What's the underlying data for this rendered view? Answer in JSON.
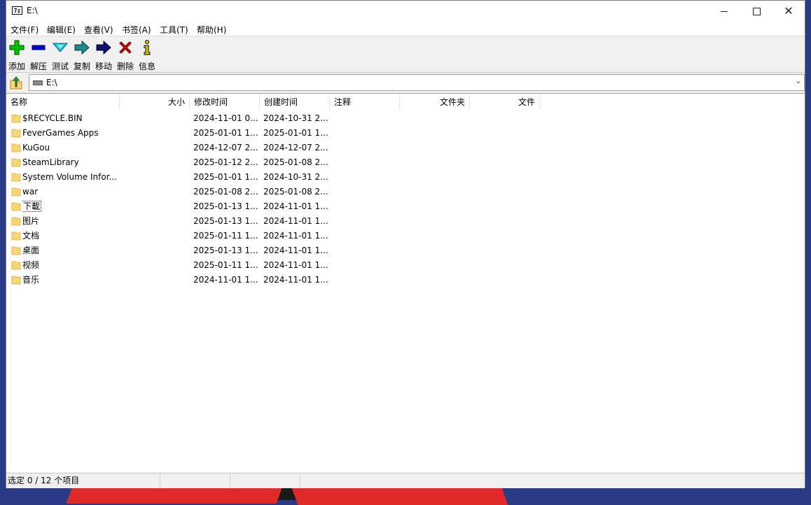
{
  "window": {
    "title": "E:\\",
    "app_icon_text": "7z"
  },
  "menu": [
    {
      "label": "文件(F)"
    },
    {
      "label": "编辑(E)"
    },
    {
      "label": "查看(V)"
    },
    {
      "label": "书签(A)"
    },
    {
      "label": "工具(T)"
    },
    {
      "label": "帮助(H)"
    }
  ],
  "toolbar": [
    {
      "label": "添加",
      "icon": "add-icon",
      "color": "#00c000"
    },
    {
      "label": "解压",
      "icon": "extract-icon",
      "color": "#0000c8"
    },
    {
      "label": "测试",
      "icon": "test-icon",
      "color": "#20c8d8"
    },
    {
      "label": "复制",
      "icon": "copy-icon",
      "color": "#1a8a8a"
    },
    {
      "label": "移动",
      "icon": "move-icon",
      "color": "#10106e"
    },
    {
      "label": "删除",
      "icon": "delete-icon",
      "color": "#d00000"
    },
    {
      "label": "信息",
      "icon": "info-icon",
      "color": "#d8c800"
    }
  ],
  "address": {
    "path": "E:\\"
  },
  "columns": {
    "name": "名称",
    "size": "大小",
    "modified": "修改时间",
    "created": "创建时间",
    "comment": "注释",
    "folders": "文件夹",
    "files": "文件"
  },
  "rows": [
    {
      "name": "$RECYCLE.BIN",
      "modified": "2024-11-01 0...",
      "created": "2024-10-31 2..."
    },
    {
      "name": "FeverGames Apps",
      "modified": "2025-01-01 1...",
      "created": "2025-01-01 1..."
    },
    {
      "name": "KuGou",
      "modified": "2024-12-07 2...",
      "created": "2024-12-07 2..."
    },
    {
      "name": "SteamLibrary",
      "modified": "2025-01-12 2...",
      "created": "2025-01-08 2..."
    },
    {
      "name": "System Volume Infor...",
      "modified": "2025-01-01 1...",
      "created": "2024-10-31 2..."
    },
    {
      "name": "war",
      "modified": "2025-01-08 2...",
      "created": "2025-01-08 2..."
    },
    {
      "name": "下載",
      "modified": "2025-01-13 1...",
      "created": "2024-11-01 1..."
    },
    {
      "name": "图片",
      "modified": "2025-01-13 1...",
      "created": "2024-11-01 1..."
    },
    {
      "name": "文档",
      "modified": "2025-01-11 1...",
      "created": "2024-11-01 1..."
    },
    {
      "name": "桌面",
      "modified": "2025-01-13 1...",
      "created": "2024-11-01 1..."
    },
    {
      "name": "视频",
      "modified": "2025-01-11 1...",
      "created": "2024-11-01 1..."
    },
    {
      "name": "音乐",
      "modified": "2024-11-01 1...",
      "created": "2024-11-01 1..."
    }
  ],
  "status": {
    "selection": "选定 0 / 12 个项目"
  },
  "colors": {
    "folder": "#f7d774",
    "folder_edge": "#d9a93c"
  }
}
